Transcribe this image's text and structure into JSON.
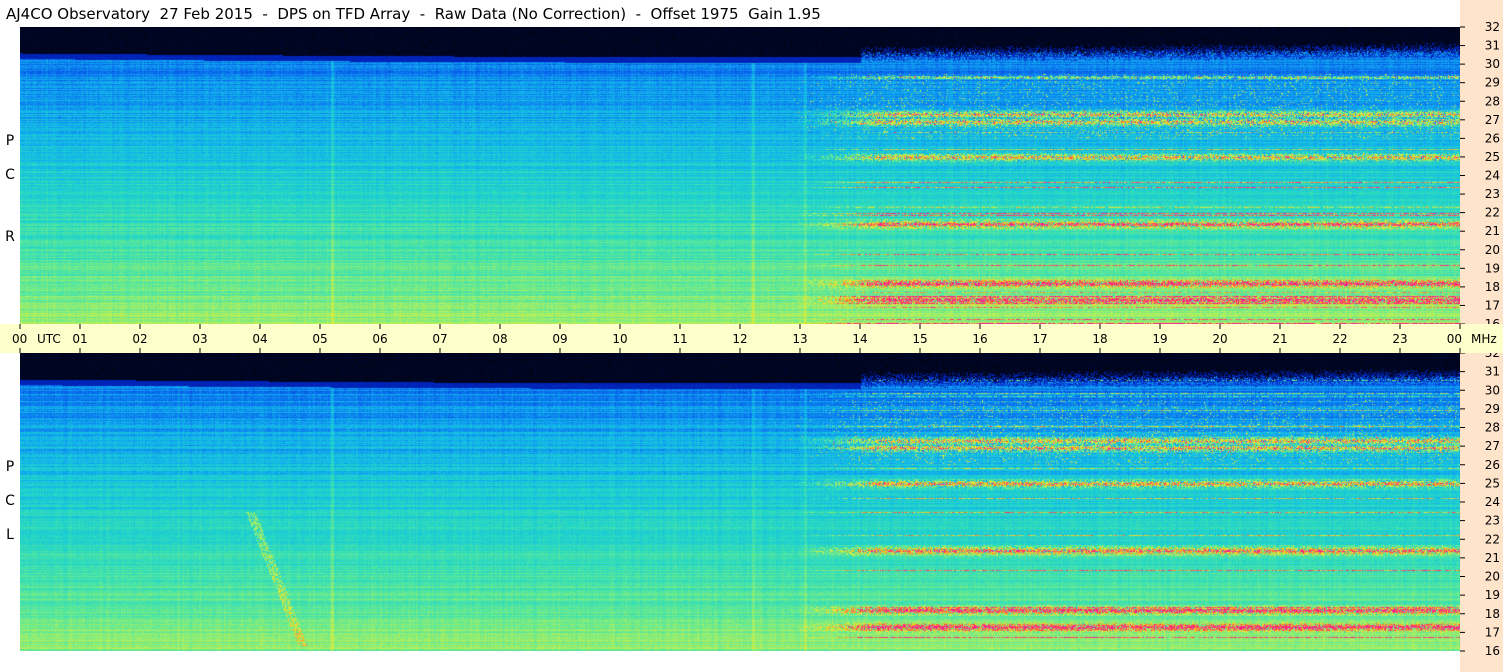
{
  "title": "AJ4CO Observatory  27 Feb 2015  -  DPS on TFD Array  -  Raw Data (No Correction)  -  Offset 1975  Gain 1.95",
  "panels": [
    {
      "id": "rcp",
      "polarization_letters": [
        "R",
        "C",
        "P"
      ]
    },
    {
      "id": "lcp",
      "polarization_letters": [
        "L",
        "C",
        "P"
      ]
    }
  ],
  "colors": {
    "utc_band": "#ffffcc",
    "freq_band": "#ffe4cc",
    "colormap": [
      "#000000",
      "#001060",
      "#0028c8",
      "#0a6cf0",
      "#12b4ec",
      "#22d6c8",
      "#5ae89a",
      "#b4f05a",
      "#f0e628",
      "#ff7828",
      "#ff1e8c"
    ]
  },
  "chart_data": {
    "type": "heatmap",
    "title": "AJ4CO Observatory  27 Feb 2015  -  DPS on TFD Array  -  Raw Data (No Correction)  -  Offset 1975  Gain 1.95",
    "x_axis": {
      "unit_label": "UTC",
      "ticks": [
        "00",
        "01",
        "02",
        "03",
        "04",
        "05",
        "06",
        "07",
        "08",
        "09",
        "10",
        "11",
        "12",
        "13",
        "14",
        "15",
        "16",
        "17",
        "18",
        "19",
        "20",
        "21",
        "22",
        "23",
        "00"
      ],
      "range": [
        0,
        24
      ]
    },
    "y_axis": {
      "unit_label": "MHz",
      "ticks": [
        16,
        17,
        18,
        19,
        20,
        21,
        22,
        23,
        24,
        25,
        26,
        27,
        28,
        29,
        30,
        31,
        32
      ],
      "range": [
        16,
        32
      ]
    },
    "series": [
      {
        "name": "RCP"
      },
      {
        "name": "LCP"
      }
    ],
    "features": {
      "background_quiet_hours": [
        0,
        12.8
      ],
      "active_hours": [
        12.8,
        24
      ],
      "top_dark_band_mhz": [
        30.3,
        32
      ],
      "intense_bands_mhz": [
        17.3,
        18.2,
        21.4,
        25.0,
        26.9,
        27.3
      ]
    }
  }
}
